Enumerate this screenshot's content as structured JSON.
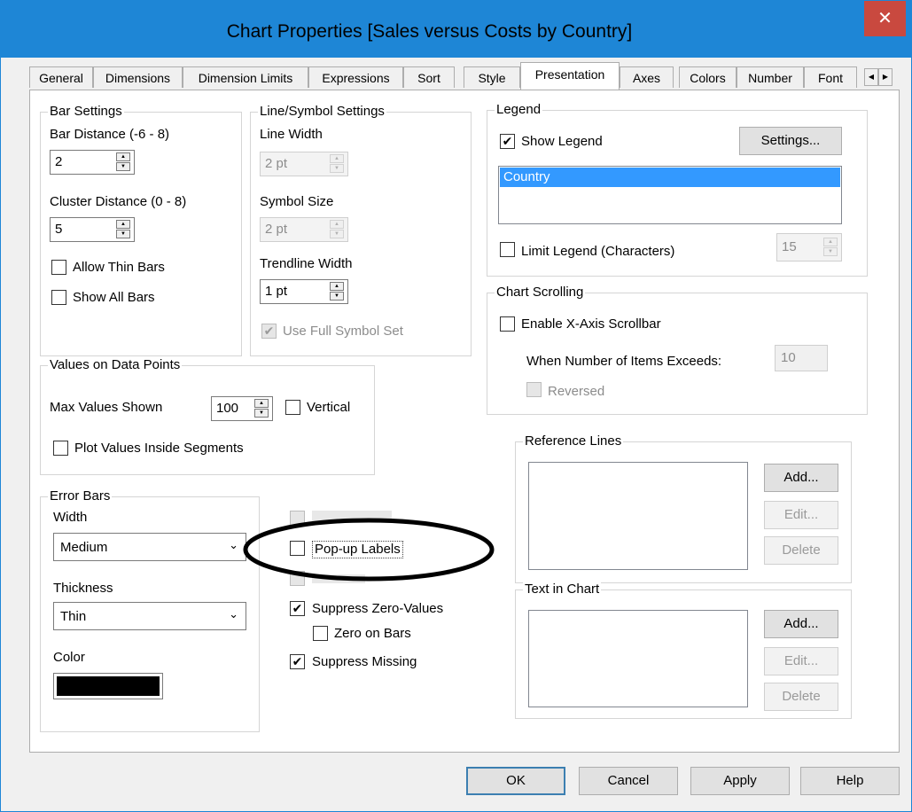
{
  "window": {
    "title": "Chart Properties [Sales versus Costs by Country]",
    "close_glyph": "✕"
  },
  "tabs": [
    {
      "label": "General"
    },
    {
      "label": "Dimensions"
    },
    {
      "label": "Dimension Limits"
    },
    {
      "label": "Expressions"
    },
    {
      "label": "Sort"
    },
    {
      "label": "Style"
    },
    {
      "label": "Presentation",
      "active": true
    },
    {
      "label": "Axes"
    },
    {
      "label": "Colors"
    },
    {
      "label": "Number"
    },
    {
      "label": "Font"
    }
  ],
  "tab_nav": {
    "left": "◀",
    "right": "▶"
  },
  "bar_settings": {
    "title": "Bar Settings",
    "bar_distance_label": "Bar Distance (-6 - 8)",
    "bar_distance_value": "2",
    "cluster_distance_label": "Cluster Distance (0 - 8)",
    "cluster_distance_value": "5",
    "allow_thin_bars": "Allow Thin Bars",
    "show_all_bars": "Show All Bars"
  },
  "line_symbol": {
    "title": "Line/Symbol Settings",
    "line_width_label": "Line Width",
    "line_width_value": "2 pt",
    "symbol_size_label": "Symbol Size",
    "symbol_size_value": "2 pt",
    "trendline_width_label": "Trendline Width",
    "trendline_width_value": "1 pt",
    "use_full_symbol_set": "Use Full Symbol Set"
  },
  "values_on_points": {
    "title": "Values on Data Points",
    "max_values_label": "Max Values Shown",
    "max_values_value": "100",
    "vertical": "Vertical",
    "plot_inside": "Plot Values Inside Segments"
  },
  "error_bars": {
    "title": "Error Bars",
    "width_label": "Width",
    "width_value": "Medium",
    "thickness_label": "Thickness",
    "thickness_value": "Thin",
    "color_label": "Color",
    "color_value": "#000000"
  },
  "misc_checks": {
    "popup_labels": "Pop-up Labels",
    "suppress_zero": "Suppress Zero-Values",
    "zero_on_bars": "Zero on Bars",
    "suppress_missing": "Suppress Missing",
    "check_glyph": "✔"
  },
  "legend": {
    "title": "Legend",
    "show_legend": "Show Legend",
    "settings_button": "Settings...",
    "items": [
      "Country"
    ],
    "limit_legend": "Limit Legend (Characters)",
    "limit_value": "15",
    "selected_color": "#3399ff"
  },
  "chart_scrolling": {
    "title": "Chart Scrolling",
    "enable_scrollbar": "Enable X-Axis Scrollbar",
    "items_exceeds_label": "When Number of Items Exceeds:",
    "items_exceeds_value": "10",
    "reversed": "Reversed"
  },
  "reference_lines": {
    "title": "Reference Lines",
    "add": "Add...",
    "edit": "Edit...",
    "delete": "Delete"
  },
  "text_in_chart": {
    "title": "Text in Chart",
    "add": "Add...",
    "edit": "Edit...",
    "delete": "Delete"
  },
  "footer": {
    "ok": "OK",
    "cancel": "Cancel",
    "apply": "Apply",
    "help": "Help"
  }
}
